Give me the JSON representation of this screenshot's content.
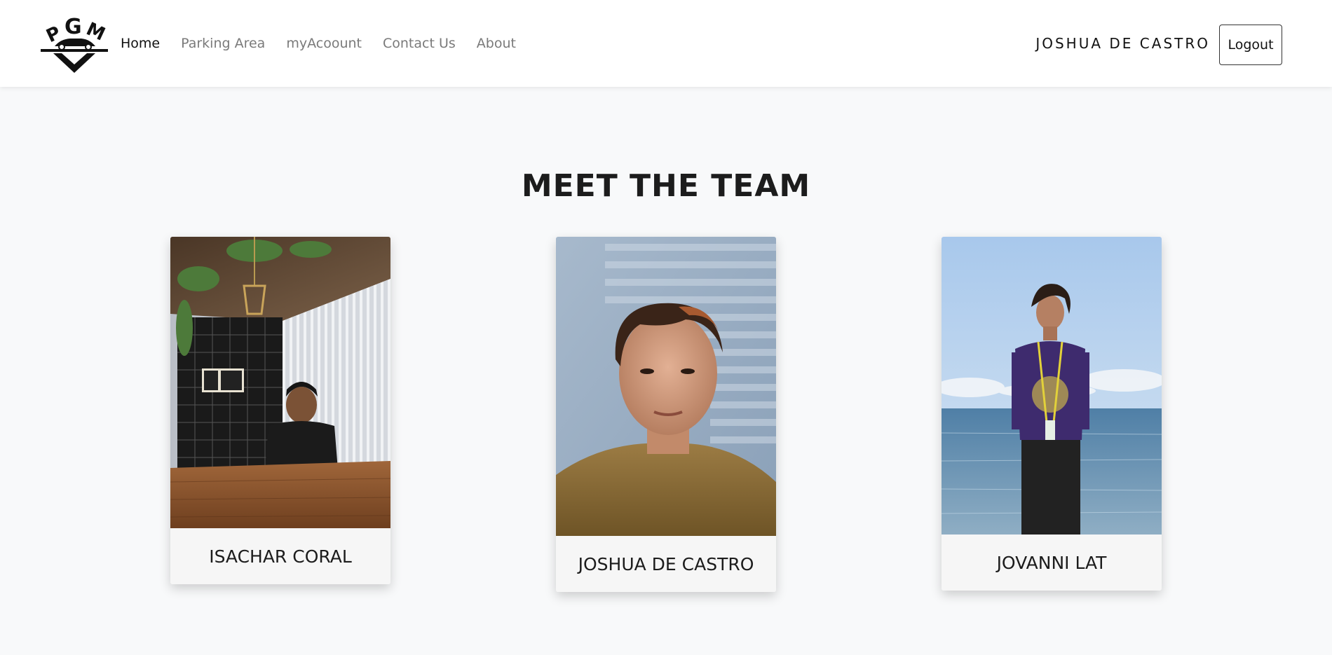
{
  "navbar": {
    "logo_letters": "PGM",
    "links": [
      {
        "label": "Home",
        "active": true
      },
      {
        "label": "Parking Area",
        "active": false
      },
      {
        "label": "myAcoount",
        "active": false
      },
      {
        "label": "Contact Us",
        "active": false
      },
      {
        "label": "About",
        "active": false
      }
    ],
    "user_name": "JOSHUA DE CASTRO",
    "logout_label": "Logout"
  },
  "team": {
    "title": "MEET THE TEAM",
    "members": [
      {
        "name": "ISACHAR CORAL"
      },
      {
        "name": "JOSHUA DE CASTRO"
      },
      {
        "name": "JOVANNI LAT"
      }
    ]
  },
  "colors": {
    "background": "#f8f9fa",
    "navbar": "#ffffff",
    "active_link": "#111111",
    "inactive_link": "#7a7a7a"
  }
}
